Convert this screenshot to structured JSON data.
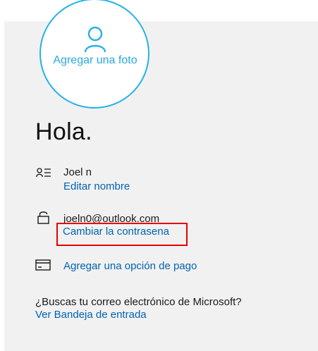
{
  "profile": {
    "add_photo_label": "Agregar una foto",
    "greeting": "Hola."
  },
  "account": {
    "name": "Joel n",
    "edit_name_label": "Editar nombre",
    "email": "joeln0@outlook.com",
    "change_password_label": "Cambiar la contrasena",
    "add_payment_label": "Agregar una opción de pago"
  },
  "mail_prompt": {
    "question": "¿Buscas tu correo electrónico de Microsoft?",
    "inbox_link": "Ver Bandeja de entrada"
  },
  "colors": {
    "accent_cyan": "#27b1e6",
    "link_blue": "#0063b1",
    "highlight_red": "#e60000",
    "panel_gray": "#f1f1f1"
  },
  "icons": {
    "person": "person-icon",
    "contact_card": "contact-card-icon",
    "lock": "lock-icon",
    "payment_card": "credit-card-icon"
  }
}
